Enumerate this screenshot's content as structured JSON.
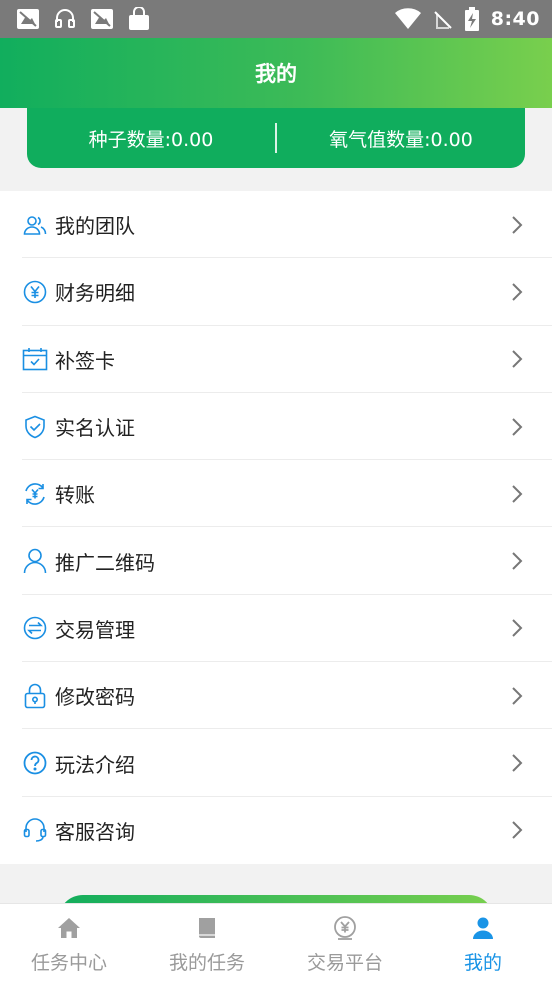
{
  "status_bar": {
    "time": "8:40",
    "left_icons": [
      "image-icon",
      "headset-icon",
      "image-icon",
      "shopping-bag-icon"
    ],
    "right_icons": [
      "wifi-icon",
      "no-sim-icon",
      "battery-charging-icon"
    ]
  },
  "header": {
    "title": "我的"
  },
  "stats": {
    "seeds": "种子数量:0.00",
    "oxygen": "氧气值数量:0.00"
  },
  "menu": {
    "items": [
      {
        "label": "我的团队",
        "icon": "team-icon"
      },
      {
        "label": "财务明细",
        "icon": "yen-circle-icon"
      },
      {
        "label": "补签卡",
        "icon": "calendar-check-icon"
      },
      {
        "label": "实名认证",
        "icon": "shield-check-icon"
      },
      {
        "label": "转账",
        "icon": "transfer-yen-icon"
      },
      {
        "label": "推广二维码",
        "icon": "user-icon"
      },
      {
        "label": "交易管理",
        "icon": "exchange-icon"
      },
      {
        "label": "修改密码",
        "icon": "lock-icon"
      },
      {
        "label": "玩法介绍",
        "icon": "question-icon"
      },
      {
        "label": "客服咨询",
        "icon": "headset-icon"
      }
    ]
  },
  "tabbar": {
    "tabs": [
      {
        "label": "任务中心",
        "icon": "home-icon",
        "active": false
      },
      {
        "label": "我的任务",
        "icon": "book-icon",
        "active": false
      },
      {
        "label": "交易平台",
        "icon": "yen-coin-icon",
        "active": false
      },
      {
        "label": "我的",
        "icon": "person-icon",
        "active": true
      }
    ]
  },
  "colors": {
    "primary_green": "#10ad5d",
    "accent_green": "#79cf4d",
    "icon_blue": "#1a8fe3",
    "active_tab": "#1a94e6",
    "inactive_tab": "#9a9a9a"
  }
}
